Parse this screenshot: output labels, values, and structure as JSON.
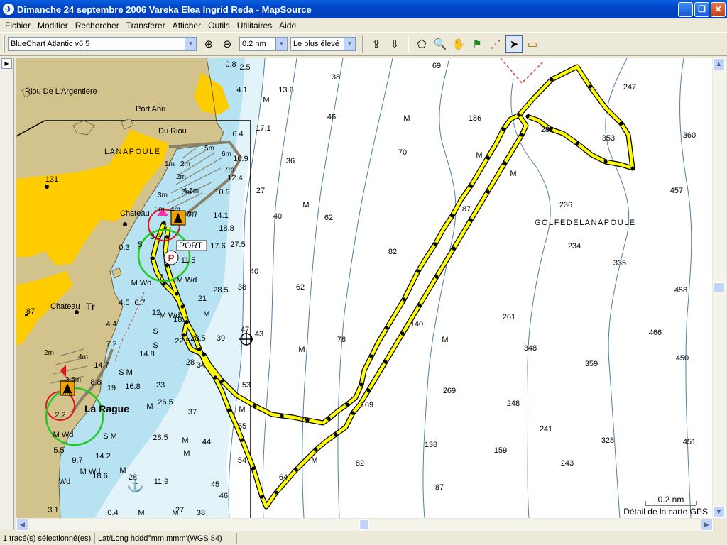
{
  "window": {
    "title": "Dimanche 24 septembre 2006 Vareka Elea Ingrid Reda - MapSource",
    "icon": "mapsource-app-icon",
    "minimize_label": "_",
    "maximize_label": "❐",
    "close_label": "✕"
  },
  "menu": {
    "items": [
      "Fichier",
      "Modifier",
      "Rechercher",
      "Transférer",
      "Afficher",
      "Outils",
      "Utilitaires",
      "Aide"
    ]
  },
  "toolbar": {
    "map_product": "BlueChart Atlantic v6.5",
    "zoom_scale": "0.2 nm",
    "detail_level": "Le plus élevé",
    "icons": [
      "zoom-in-icon",
      "zoom-out-icon",
      "send-to-device-icon",
      "receive-from-device-icon",
      "selection-tool-icon",
      "zoom-tool-icon",
      "hand-tool-icon",
      "waypoint-flag-icon",
      "route-tool-icon",
      "pointer-tool-icon",
      "measure-tool-icon"
    ]
  },
  "map": {
    "colors": {
      "land": "#d2c38c",
      "urban": "#ffcc00",
      "shallow_water": "#b6e2f2",
      "mid_water": "#e2f4fa",
      "deep_water": "#ffffff",
      "contour": "#4f7fa8",
      "track": "#ffff00",
      "track_point": "#000000"
    },
    "place_labels": {
      "riou_argentiere": "Riou De L'Argentiere",
      "port_abri": "Port Abri",
      "du_riou": "Du Riou",
      "lanapoule": "LANAPOULE",
      "chateau_top": "Chateau",
      "chateau_mid": "Chateau",
      "tr": "Tr",
      "port": "PORT",
      "la_rague": "La Rague",
      "golfe": "GOLFEDELANAPOULE"
    },
    "port_symbol": "P",
    "depth_soundings": [
      "38",
      "69",
      "247",
      "46",
      "186",
      "282",
      "353",
      "360",
      "70",
      "36",
      "236",
      "457",
      "27",
      "40",
      "62",
      "87",
      "82",
      "234",
      "335",
      "40",
      "62",
      "458",
      "38",
      "261",
      "140",
      "466",
      "47",
      "43",
      "78",
      "348",
      "359",
      "450",
      "39",
      "169",
      "269",
      "248",
      "53",
      "55",
      "75",
      "241",
      "328",
      "451",
      "44",
      "138",
      "159",
      "243",
      "82",
      "87",
      "64",
      "54",
      "0.8",
      "2.5",
      "4.1",
      "13.6",
      "6.4",
      "17.1",
      "10.9",
      "12.4",
      "10.9",
      "14.1",
      "18.8",
      "27.5",
      "17.6",
      "11.5",
      "21",
      "28.5",
      "18.2",
      "22.5",
      "28.5",
      "26.5",
      "23",
      "28",
      "34",
      "37",
      "28.5",
      "44",
      "45",
      "46",
      "38",
      "27",
      "12",
      "14.8",
      "14.7",
      "19",
      "16.8",
      "14.2",
      "18.6",
      "28",
      "11.9",
      "9.7",
      "0.4",
      "3.1",
      "5.5",
      "7",
      "4.5",
      "6.7",
      "4.4",
      "7.2",
      "2.2",
      "8.8",
      "0.3",
      "3.3",
      "7.7",
      "87",
      "131"
    ],
    "seabed_marks": [
      "M",
      "M",
      "M",
      "M",
      "M",
      "M",
      "M",
      "M",
      "M",
      "M",
      "M",
      "M",
      "M",
      "M",
      "M",
      "M",
      "M Wd",
      "M Wd",
      "M Wd",
      "M Wd",
      "M Wd",
      "S",
      "S",
      "S",
      "S M",
      "S M",
      "Wd"
    ],
    "harbour_depths": [
      "5m",
      "6m",
      "7m",
      "1m",
      "2m",
      "3m",
      "4.5m",
      "3m",
      "2m",
      "3m",
      "2m",
      "4m",
      "3.5m",
      "4m",
      "7m",
      "4m"
    ],
    "scale_bar": "0.2 nm",
    "detail_caption": "Détail de la carte GPS",
    "cursor_readout_icon": "crosshair-icon",
    "anchor_icon": "anchorage-icon"
  },
  "status": {
    "selection": "1 tracé(s) sélectionné(es)",
    "coordinate_format": "Lat/Long hddd°mm.mmm'(WGS 84)"
  }
}
